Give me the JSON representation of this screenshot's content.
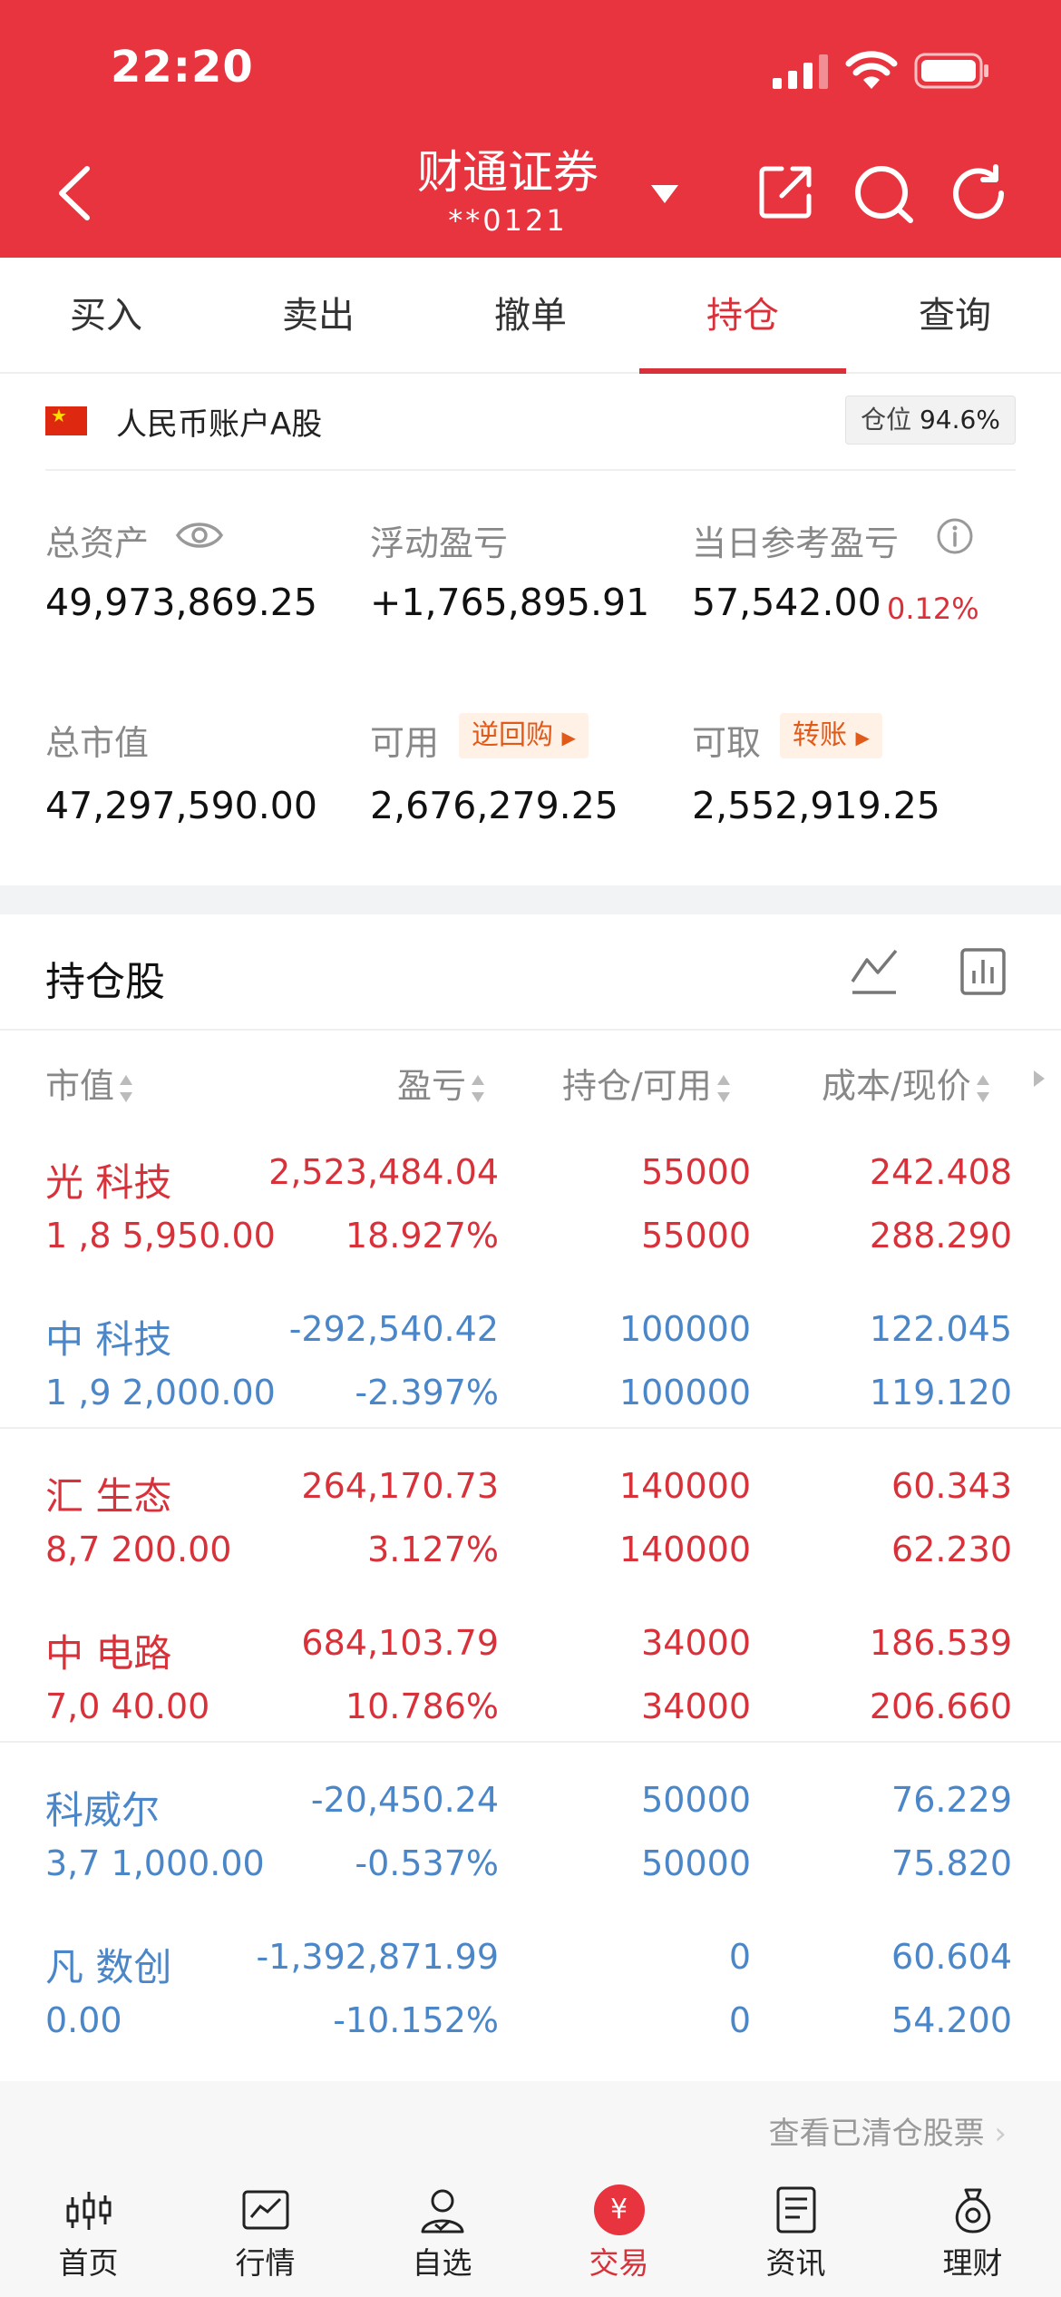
{
  "status": {
    "time": "22:20"
  },
  "header": {
    "broker": "财通证券",
    "account": "**0121"
  },
  "tabs": [
    "买入",
    "卖出",
    "撤单",
    "持仓",
    "查询"
  ],
  "active_tab": 3,
  "account": {
    "type": "人民币账户A股",
    "position_label": "仓位",
    "position_value": "94.6%"
  },
  "summary": {
    "total_assets_label": "总资产",
    "total_assets": "49,973,869.25",
    "floating_pl_label": "浮动盈亏",
    "floating_pl": "+1,765,895.91",
    "daily_pl_label": "当日参考盈亏",
    "daily_pl": "57,542.00",
    "daily_pl_pct": "0.12%",
    "market_value_label": "总市值",
    "market_value": "47,297,590.00",
    "available_label": "可用",
    "repo_button": "逆回购",
    "available": "2,676,279.25",
    "withdrawable_label": "可取",
    "transfer_button": "转账",
    "withdrawable": "2,552,919.25"
  },
  "holdings": {
    "title": "持仓股",
    "columns": [
      "市值",
      "盈亏",
      "持仓/可用",
      "成本/现价"
    ],
    "rows": [
      {
        "name": "光   科技",
        "value": "1 ,8  5,950.00",
        "pl": "2,523,484.04",
        "pl_pct": "18.927%",
        "hold": "55000",
        "avail": "55000",
        "cost": "242.408",
        "price": "288.290",
        "color": "red"
      },
      {
        "name": "中   科技",
        "value": "1 ,9  2,000.00",
        "pl": "-292,540.42",
        "pl_pct": "-2.397%",
        "hold": "100000",
        "avail": "100000",
        "cost": "122.045",
        "price": "119.120",
        "color": "blue"
      },
      {
        "name": "汇   生态",
        "value": "8,7   200.00",
        "pl": "264,170.73",
        "pl_pct": "3.127%",
        "hold": "140000",
        "avail": "140000",
        "cost": "60.343",
        "price": "62.230",
        "color": "red"
      },
      {
        "name": "中   电路",
        "value": "7,0   40.00",
        "pl": "684,103.79",
        "pl_pct": "10.786%",
        "hold": "34000",
        "avail": "34000",
        "cost": "186.539",
        "price": "206.660",
        "color": "red"
      },
      {
        "name": "科威尔",
        "value": "3,7  1,000.00",
        "pl": "-20,450.24",
        "pl_pct": "-0.537%",
        "hold": "50000",
        "avail": "50000",
        "cost": "76.229",
        "price": "75.820",
        "color": "blue"
      },
      {
        "name": "凡   数创",
        "value": "0.00",
        "pl": "-1,392,871.99",
        "pl_pct": "-10.152%",
        "hold": "0",
        "avail": "0",
        "cost": "60.604",
        "price": "54.200",
        "color": "blue"
      }
    ],
    "cleared_link": "查看已清仓股票"
  },
  "nav": [
    "首页",
    "行情",
    "自选",
    "交易",
    "资讯",
    "理财"
  ],
  "nav_active": 3,
  "colors": {
    "brand_red": "#e8343e",
    "gain_red": "#d8313a",
    "loss_blue": "#4a86c8",
    "tag_orange": "#e05a1a"
  }
}
